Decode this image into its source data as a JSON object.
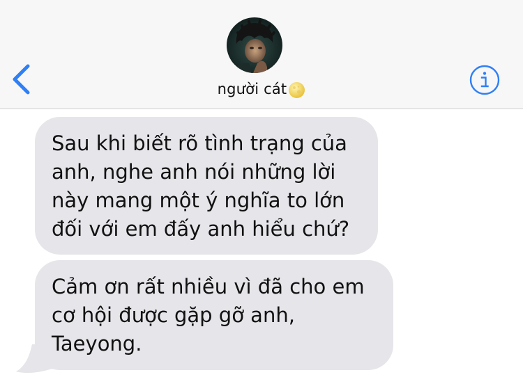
{
  "header": {
    "contact_name": "người cát",
    "back_icon": "chevron-left-icon",
    "info_icon": "info-icon",
    "status_emoji": "moon-icon",
    "accent_color": "#2f7ff5"
  },
  "messages": [
    {
      "direction": "received",
      "text": "Sau khi biết rõ tình trạng của anh, nghe anh nói những lời này mang một ý nghĩa to lớn đối với em đấy anh hiểu chứ?"
    },
    {
      "direction": "received",
      "text": "Cảm ơn rất nhiều vì đã cho em cơ hội được gặp gỡ anh, Taeyong."
    }
  ],
  "colors": {
    "header_background": "#f7f7f7",
    "received_bubble": "#e5e5ea",
    "text": "#111111"
  }
}
